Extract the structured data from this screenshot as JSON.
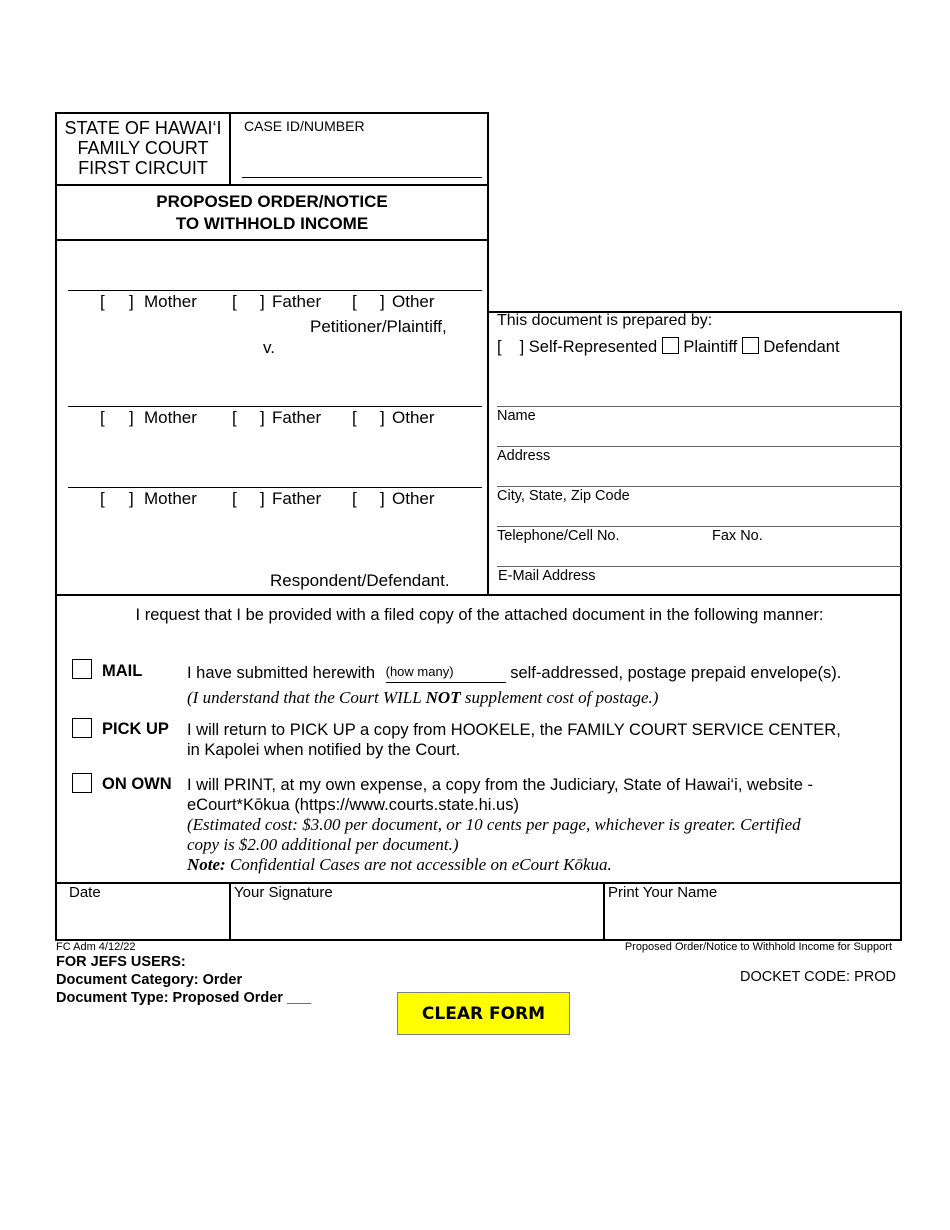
{
  "header": {
    "court_lines": [
      "STATE OF HAWAI‘I",
      "FAMILY COURT",
      "FIRST CIRCUIT"
    ],
    "case_id_label": "CASE ID/NUMBER",
    "case_id_value": "",
    "title_lines": [
      "PROPOSED ORDER/NOTICE",
      "TO WITHHOLD INCOME"
    ]
  },
  "parties": {
    "bracket_open": "[",
    "bracket_close": "]",
    "options": [
      "Mother",
      "Father",
      "Other"
    ],
    "petitioner_label": "Petitioner/Plaintiff,",
    "versus": "v.",
    "respondent_label": "Respondent/Defendant."
  },
  "preparer": {
    "heading": "This document is prepared by:",
    "self_represented": "Self-Represented",
    "plaintiff": "Plaintiff",
    "defendant": "Defendant",
    "fields": {
      "name": "Name",
      "address": "Address",
      "city": "City, State, Zip Code",
      "telephone": "Telephone/Cell No.",
      "fax": "Fax No.",
      "email": "E-Mail Address"
    }
  },
  "request": {
    "intro": "I request that I be provided with a filed copy of the attached document in the following manner:",
    "mail": {
      "label": "MAIL",
      "text_before": "I have submitted herewith",
      "how_many_placeholder": "(how many)",
      "text_after": "self-addressed, postage prepaid envelope(s).",
      "note_pre": "(I understand that the Court WILL ",
      "note_bold": "NOT",
      "note_post": " supplement cost of postage.)"
    },
    "pickup": {
      "label": "PICK UP",
      "line1": "I will return to PICK UP a copy from HOOKELE, the FAMILY COURT SERVICE CENTER,",
      "line2": "in Kapolei when notified by the Court."
    },
    "own": {
      "label": "ON OWN",
      "line1": "I will PRINT, at my own expense, a copy from the Judiciary, State of Hawai‘i, website -",
      "line2": "eCourt*Kōkua (https://www.courts.state.hi.us)",
      "line3": "(Estimated cost:  $3.00 per document, or 10 cents per page, whichever is greater.  Certified",
      "line4": "copy is $2.00 additional per document.)",
      "note_bold": "Note:",
      "note_text": "  Confidential Cases are not accessible on eCourt Kōkua."
    }
  },
  "signature": {
    "date": "Date",
    "your_signature": "Your Signature",
    "print_name": "Print Your Name"
  },
  "footer": {
    "form_id": "FC Adm 4/12/22",
    "form_title": "Proposed Order/Notice to Withhold Income for Support",
    "jefs_heading": "FOR JEFS USERS:",
    "doc_category": "Document Category:  Order",
    "doc_type": "Document Type:  Proposed Order ___",
    "docket_code": "DOCKET CODE: PROD",
    "clear_button": "CLEAR FORM"
  },
  "colors": {
    "clear_button_bg": "#ffff00"
  }
}
